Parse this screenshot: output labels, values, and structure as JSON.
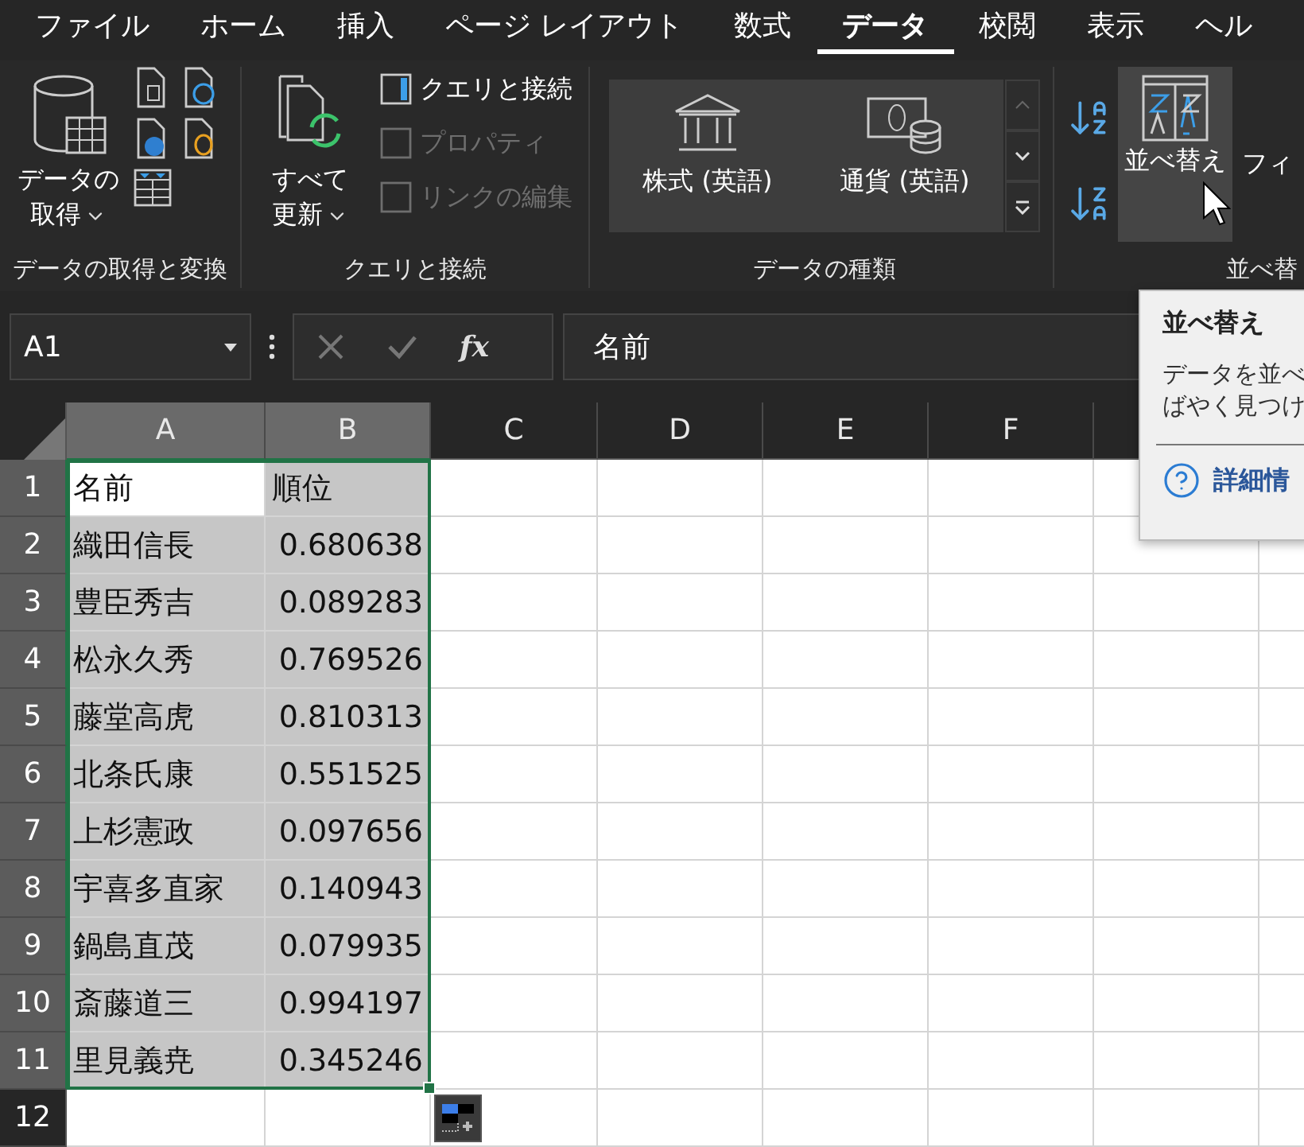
{
  "menu_tabs": [
    {
      "label": "ファイル",
      "selected": false
    },
    {
      "label": "ホーム",
      "selected": false
    },
    {
      "label": "挿入",
      "selected": false
    },
    {
      "label": "ページ レイアウト",
      "selected": false
    },
    {
      "label": "数式",
      "selected": false
    },
    {
      "label": "データ",
      "selected": true
    },
    {
      "label": "校閲",
      "selected": false
    },
    {
      "label": "表示",
      "selected": false
    },
    {
      "label": "ヘル",
      "selected": false
    }
  ],
  "ribbon": {
    "groups": [
      {
        "kind": "get",
        "label": "データの取得と変換",
        "button": "データの取得"
      },
      {
        "kind": "queries",
        "label": "クエリと接続",
        "button": "すべて更新",
        "items": [
          {
            "label": "クエリと接続",
            "disabled": false
          },
          {
            "label": "プロパティ",
            "disabled": true
          },
          {
            "label": "リンクの編集",
            "disabled": true
          }
        ]
      },
      {
        "kind": "types",
        "label": "データの種類",
        "items": [
          "株式 (英語)",
          "通貨 (英語)"
        ]
      },
      {
        "kind": "sort",
        "label": "並べ替",
        "button": "並べ替え",
        "hovered": true,
        "next_button": "フィ"
      }
    ]
  },
  "formula_bar": {
    "name_box": "A1",
    "fx": "fx",
    "value": "名前"
  },
  "sheet": {
    "columns": [
      {
        "label": "A",
        "selected": true
      },
      {
        "label": "B",
        "selected": true
      },
      {
        "label": "C",
        "selected": false
      },
      {
        "label": "D",
        "selected": false
      },
      {
        "label": "E",
        "selected": false
      },
      {
        "label": "F",
        "selected": false
      }
    ],
    "rows": [
      {
        "label": "1",
        "selected": true,
        "cells": [
          {
            "text": "名前",
            "kind": "text",
            "selected": true,
            "active": true
          },
          {
            "text": "順位",
            "kind": "text",
            "selected": true,
            "active": false
          }
        ]
      },
      {
        "label": "2",
        "selected": true,
        "cells": [
          {
            "text": "織田信長",
            "kind": "text",
            "selected": true,
            "active": false
          },
          {
            "text": "0.680638",
            "kind": "number",
            "selected": true,
            "active": false
          }
        ]
      },
      {
        "label": "3",
        "selected": true,
        "cells": [
          {
            "text": "豊臣秀吉",
            "kind": "text",
            "selected": true,
            "active": false
          },
          {
            "text": "0.089283",
            "kind": "number",
            "selected": true,
            "active": false
          }
        ]
      },
      {
        "label": "4",
        "selected": true,
        "cells": [
          {
            "text": "松永久秀",
            "kind": "text",
            "selected": true,
            "active": false
          },
          {
            "text": "0.769526",
            "kind": "number",
            "selected": true,
            "active": false
          }
        ]
      },
      {
        "label": "5",
        "selected": true,
        "cells": [
          {
            "text": "藤堂高虎",
            "kind": "text",
            "selected": true,
            "active": false
          },
          {
            "text": "0.810313",
            "kind": "number",
            "selected": true,
            "active": false
          }
        ]
      },
      {
        "label": "6",
        "selected": true,
        "cells": [
          {
            "text": "北条氏康",
            "kind": "text",
            "selected": true,
            "active": false
          },
          {
            "text": "0.551525",
            "kind": "number",
            "selected": true,
            "active": false
          }
        ]
      },
      {
        "label": "7",
        "selected": true,
        "cells": [
          {
            "text": "上杉憲政",
            "kind": "text",
            "selected": true,
            "active": false
          },
          {
            "text": "0.097656",
            "kind": "number",
            "selected": true,
            "active": false
          }
        ]
      },
      {
        "label": "8",
        "selected": true,
        "cells": [
          {
            "text": "宇喜多直家",
            "kind": "text",
            "selected": true,
            "active": false
          },
          {
            "text": "0.140943",
            "kind": "number",
            "selected": true,
            "active": false
          }
        ]
      },
      {
        "label": "9",
        "selected": true,
        "cells": [
          {
            "text": "鍋島直茂",
            "kind": "text",
            "selected": true,
            "active": false
          },
          {
            "text": "0.079935",
            "kind": "number",
            "selected": true,
            "active": false
          }
        ]
      },
      {
        "label": "10",
        "selected": true,
        "cells": [
          {
            "text": "斎藤道三",
            "kind": "text",
            "selected": true,
            "active": false
          },
          {
            "text": "0.994197",
            "kind": "number",
            "selected": true,
            "active": false
          }
        ]
      },
      {
        "label": "11",
        "selected": true,
        "cells": [
          {
            "text": "里見義尭",
            "kind": "text",
            "selected": true,
            "active": false
          },
          {
            "text": "0.345246",
            "kind": "number",
            "selected": true,
            "active": false
          }
        ]
      },
      {
        "label": "12",
        "selected": false,
        "cells": []
      }
    ]
  },
  "tooltip": {
    "title": "並べ替え",
    "lines": [
      "データを並べ",
      "ばやく見つけ"
    ],
    "link": "詳細情"
  }
}
